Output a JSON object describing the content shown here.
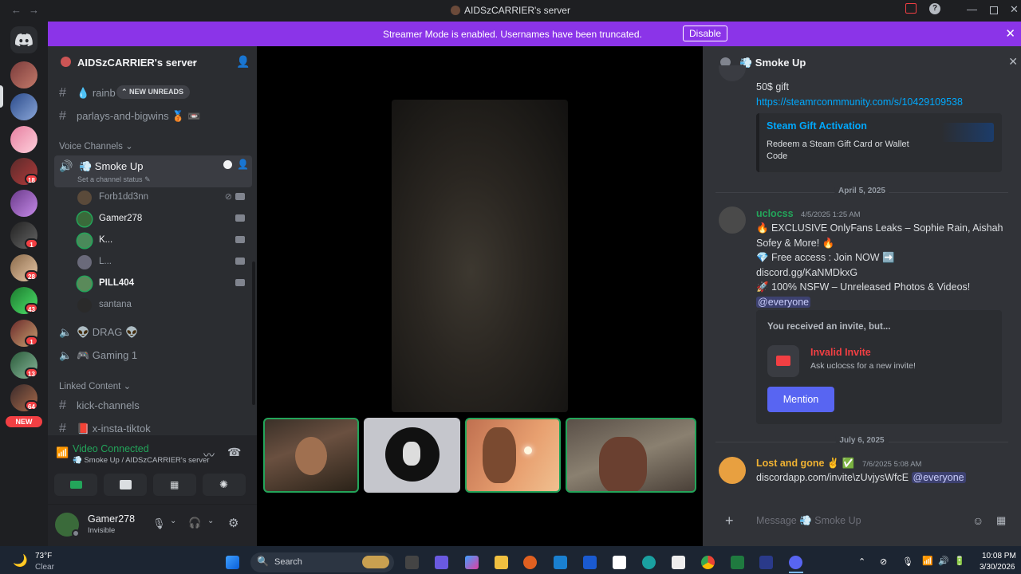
{
  "window": {
    "title": "AIDSzCARRIER's server"
  },
  "banner": {
    "text": "Streamer Mode is enabled. Usernames have been truncated.",
    "button": "Disable"
  },
  "rail": {
    "badges": [
      "18",
      "1",
      "28",
      "43",
      "1",
      "13",
      "64"
    ],
    "new_label": "NEW"
  },
  "sidebar": {
    "server_name": "AIDSzCARRIER's server",
    "new_unreads": "NEW UNREADS",
    "text_channels": [
      {
        "name": "rainb"
      },
      {
        "name": "parlays-and-bigwins 🥉 📼"
      }
    ],
    "voice_category": "Voice Channels",
    "active_voice": {
      "name": "💨 Smoke Up",
      "status": "Set a channel status"
    },
    "voice_users": [
      {
        "name": "Forb1dd3nn"
      },
      {
        "name": "Gamer278"
      },
      {
        "name": "K..."
      },
      {
        "name": "L..."
      },
      {
        "name": "PILL404"
      },
      {
        "name": "santana"
      }
    ],
    "voice_channels": [
      {
        "name": "👽 DRAG 👽"
      },
      {
        "name": "🎮 Gaming 1"
      }
    ],
    "linked_category": "Linked Content",
    "linked_channels": [
      {
        "name": "kick-channels"
      },
      {
        "name": "📕 x-insta-tiktok"
      }
    ]
  },
  "voice_panel": {
    "status": "Video Connected",
    "location": "💨 Smoke Up / AIDSzCARRIER's server"
  },
  "user_panel": {
    "username": "Gamer278",
    "status": "Invisible"
  },
  "chat": {
    "channel": "💨 Smoke Up",
    "msg0": {
      "text": "50$ gift",
      "link": "https://steamrconmmunity.com/s/10429109538",
      "embed_title": "Steam Gift Activation",
      "embed_desc_1": "Redeem a Steam Gift Card or Wallet",
      "embed_desc_2": "Code"
    },
    "date1": "April 5, 2025",
    "msg1": {
      "author": "uclocss",
      "time": "4/5/2025 1:25 AM",
      "line1": "🔥 EXCLUSIVE OnlyFans Leaks – Sophie Rain, Aishah",
      "line2": "Sofey & More! 🔥",
      "line3": "💎 Free access : Join NOW ➡️",
      "line4": "discord.gg/KaNMDkxG",
      "line5": "🚀 100% NSFW – Unreleased Photos & Videos!",
      "mention": "@everyone",
      "invite_header": "You received an invite, but...",
      "invite_title": "Invalid Invite",
      "invite_sub": "Ask uclocss for a new invite!",
      "invite_button": "Mention"
    },
    "date2": "July 6, 2025",
    "msg2": {
      "author": "Lost and gone ✌️ ✅",
      "time": "7/6/2025 5:08 AM",
      "text": "discordapp.com/invite\\zUvjysWfcE",
      "mention": "@everyone"
    },
    "input_placeholder": "Message 💨 Smoke Up"
  },
  "taskbar": {
    "weather_temp": "73°F",
    "weather_cond": "Clear",
    "search": "Search",
    "time": "10:08 PM",
    "date": "3/30/2026"
  },
  "colors": {
    "accent": "#5865f2",
    "banner": "#8b34e8",
    "online": "#23a55a",
    "link": "#00a8fc",
    "danger": "#f23f43"
  }
}
